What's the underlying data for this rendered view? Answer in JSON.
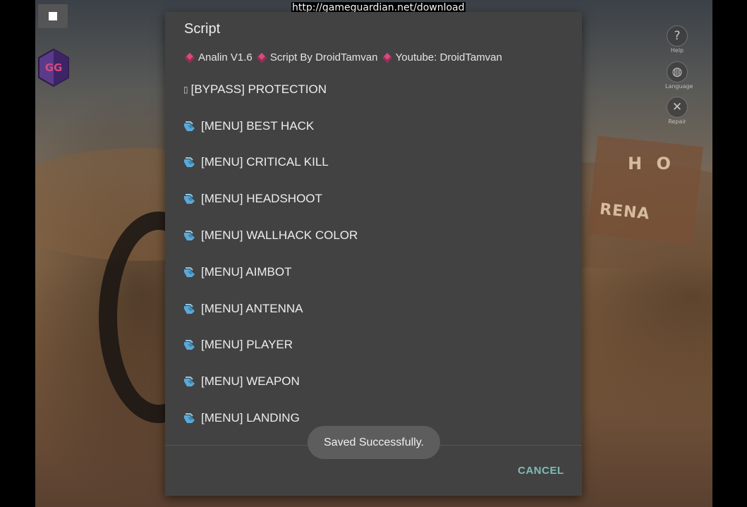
{
  "url_banner": "http://gameguardian.net/download",
  "floating_button": {
    "icon": "stop-square-icon"
  },
  "app_logo": {
    "text": "GG",
    "colors": {
      "primary": "#5b3a8a",
      "secondary": "#d64a7e"
    }
  },
  "side_icons": [
    {
      "icon": "help-icon",
      "glyph": "?",
      "label": "Help"
    },
    {
      "icon": "globe-icon",
      "glyph": "◍",
      "label": "Language"
    },
    {
      "icon": "repair-icon",
      "glyph": "✕",
      "label": "Repair"
    }
  ],
  "game_scene": {
    "sign_top": "H O",
    "sign_bottom": "RENA"
  },
  "dialog": {
    "title": "Script",
    "subtitle": {
      "parts": [
        "Analin V1.6",
        "Script By DroidTamvan",
        "Youtube: DroidTamvan"
      ],
      "separator_icon": "diamond-icon",
      "separator_color": "#d64a7e"
    },
    "items": [
      {
        "icon": "box-icon",
        "label": "[BYPASS] PROTECTION"
      },
      {
        "icon": "pointing-hand-icon",
        "label": "[MENU] BEST HACK"
      },
      {
        "icon": "pointing-hand-icon",
        "label": "[MENU] CRITICAL KILL"
      },
      {
        "icon": "pointing-hand-icon",
        "label": "[MENU] HEADSHOOT"
      },
      {
        "icon": "pointing-hand-icon",
        "label": "[MENU] WALLHACK COLOR"
      },
      {
        "icon": "pointing-hand-icon",
        "label": "[MENU] AIMBOT"
      },
      {
        "icon": "pointing-hand-icon",
        "label": "[MENU] ANTENNA"
      },
      {
        "icon": "pointing-hand-icon",
        "label": "[MENU] PLAYER"
      },
      {
        "icon": "pointing-hand-icon",
        "label": "[MENU] WEAPON"
      },
      {
        "icon": "pointing-hand-icon",
        "label": "[MENU] LANDING"
      }
    ],
    "cancel_label": "CANCEL",
    "accent_color": "#7fbcb5"
  },
  "toast": {
    "text": "Saved Successfully."
  }
}
